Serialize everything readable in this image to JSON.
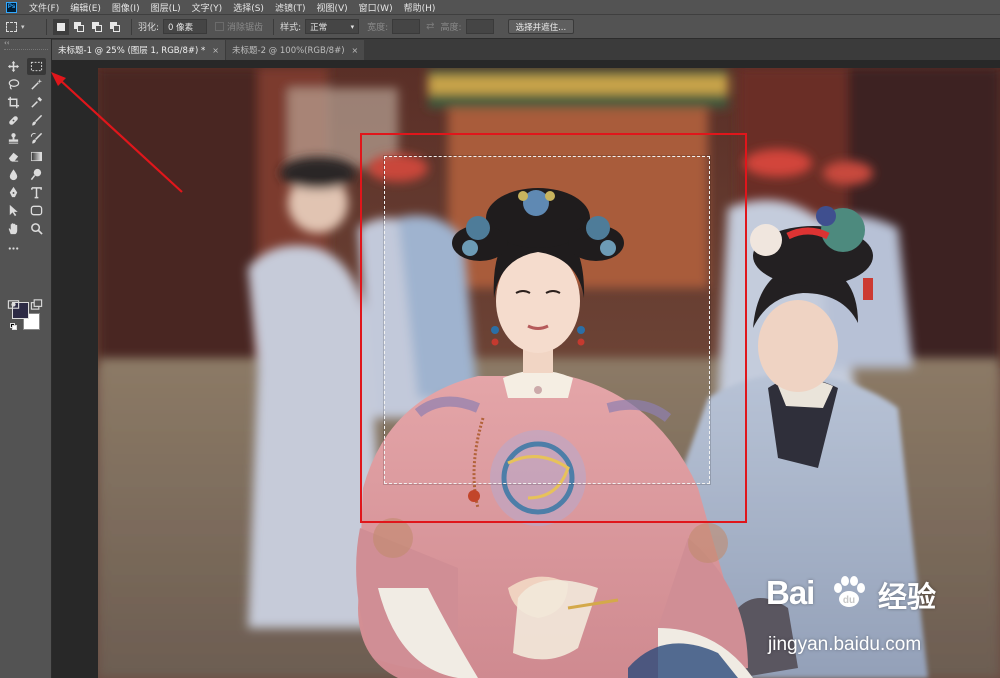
{
  "app": {
    "logo_text": "Ps"
  },
  "menu": [
    "文件(F)",
    "编辑(E)",
    "图像(I)",
    "图层(L)",
    "文字(Y)",
    "选择(S)",
    "滤镜(T)",
    "视图(V)",
    "窗口(W)",
    "帮助(H)"
  ],
  "options_bar": {
    "feather_label": "羽化:",
    "feather_value": "0 像素",
    "antialias_label": "消除锯齿",
    "style_label": "样式:",
    "style_value": "正常",
    "width_label": "宽度:",
    "height_label": "高度:",
    "select_mask_button": "选择并遮住..."
  },
  "tabs": [
    {
      "label": "未标题-1 @ 25% (图层 1, RGB/8#) *",
      "active": true
    },
    {
      "label": "未标题-2 @ 100%(RGB/8#)",
      "active": false
    }
  ],
  "tools": [
    "move-tool",
    "rectangular-marquee-tool",
    "lasso-tool",
    "magic-wand-tool",
    "crop-tool",
    "eyedropper-tool",
    "healing-brush-tool",
    "brush-tool",
    "clone-stamp-tool",
    "history-brush-tool",
    "eraser-tool",
    "gradient-tool",
    "blur-tool",
    "dodge-tool",
    "pen-tool",
    "type-tool",
    "path-selection-tool",
    "shape-tool",
    "hand-tool",
    "zoom-tool",
    "more-tools",
    "quick-mask-mode",
    "screen-mode"
  ],
  "colors": {
    "foreground": "#2d2b45",
    "background": "#ffffff",
    "annotation_red": "#e0161b"
  },
  "watermark": {
    "logo": "Bai",
    "logo_tail": "经验",
    "url": "jingyan.baidu.com"
  }
}
